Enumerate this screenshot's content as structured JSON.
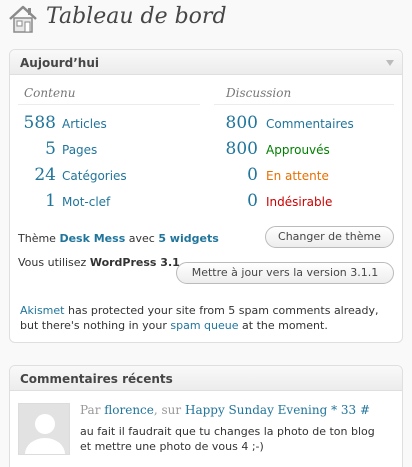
{
  "header": {
    "title": "Tableau de bord",
    "icon": "home-icon"
  },
  "today": {
    "title": "Aujourd’hui",
    "content_heading": "Contenu",
    "discussion_heading": "Discussion",
    "content": [
      {
        "count": "588",
        "label": "Articles"
      },
      {
        "count": "5",
        "label": "Pages"
      },
      {
        "count": "24",
        "label": "Catégories"
      },
      {
        "count": "1",
        "label": "Mot-clef"
      }
    ],
    "discussion": [
      {
        "count": "800",
        "label": "Commentaires",
        "color": "#21759b"
      },
      {
        "count": "800",
        "label": "Approuvés",
        "color": "#008000"
      },
      {
        "count": "0",
        "label": "En attente",
        "color": "#e66f00"
      },
      {
        "count": "0",
        "label": "Indésirable",
        "color": "#cc0000"
      }
    ],
    "theme_prefix": "Thème",
    "theme_name": "Desk Mess",
    "theme_mid": "avec",
    "theme_widgets": "5 widgets",
    "change_theme_button": "Changer de thème",
    "version_prefix": "Vous utilisez",
    "version_name": "WordPress 3.1",
    "update_button": "Mettre à jour vers la version 3.1.1",
    "akismet_link": "Akismet",
    "akismet_text": "has protected your site from 5 spam comments already,",
    "akismet_text2": "but there's nothing in your",
    "spam_link": "spam queue",
    "akismet_end": "at the moment."
  },
  "recent_comments": {
    "title": "Commentaires récents",
    "comment": {
      "by": "Par",
      "author": "florence",
      "on": ", sur",
      "post": "Happy Sunday Evening * 33",
      "hash": "#",
      "line1": "au fait il faudrait que tu changes la photo de ton blog",
      "line2": "et mettre une photo de vous 4 ;-)"
    }
  }
}
